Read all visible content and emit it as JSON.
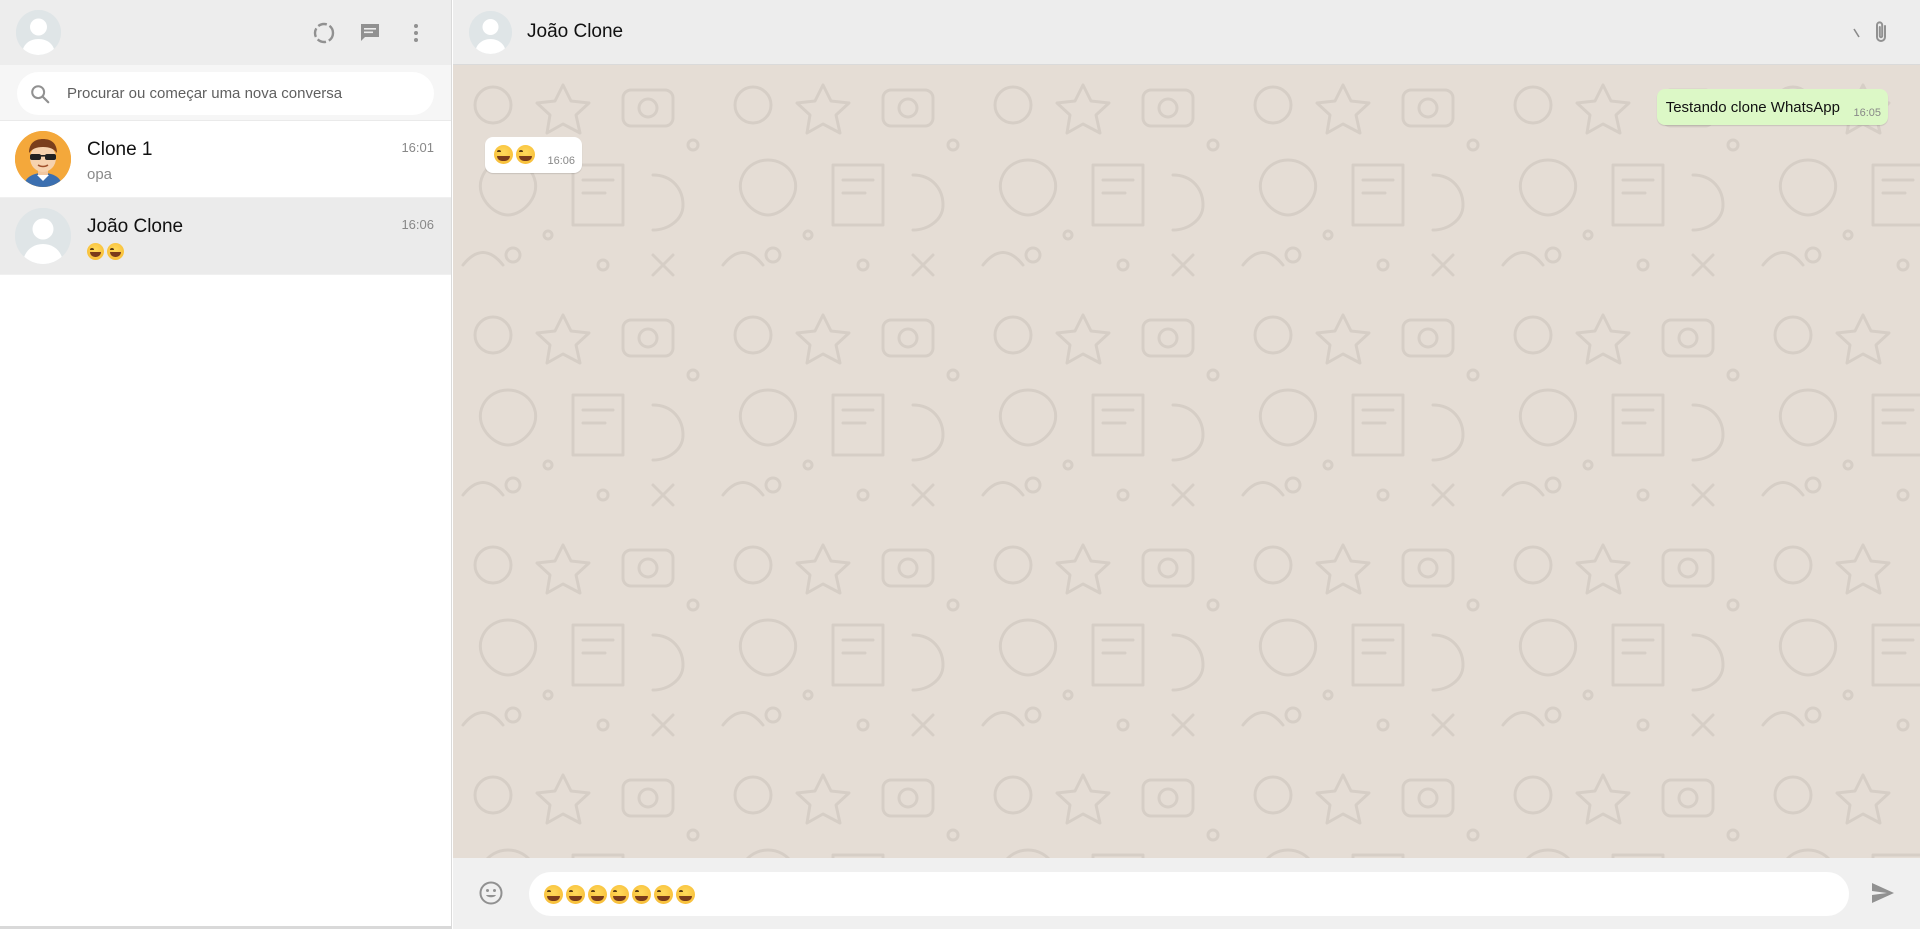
{
  "sidebar": {
    "icons": {
      "status": "status-icon",
      "new_chat": "message-icon",
      "menu": "menu-dots-icon"
    },
    "search": {
      "placeholder": "Procurar ou começar uma nova conversa",
      "value": ""
    },
    "chats": [
      {
        "name": "Clone 1",
        "time": "16:01",
        "last_message": "opa",
        "avatar": "cartoon-avatar"
      },
      {
        "name": "João Clone",
        "time": "16:06",
        "last_message_emoji_count": 2,
        "avatar": "default-avatar",
        "active": true
      }
    ]
  },
  "main": {
    "header": {
      "contact_name": "João Clone",
      "icons": {
        "attach": "paperclip-icon"
      }
    },
    "messages": [
      {
        "direction": "out",
        "text": "Testando clone WhatsApp",
        "time": "16:05"
      },
      {
        "direction": "in",
        "emoji_count": 2,
        "time": "16:06"
      }
    ],
    "composer": {
      "emoji_icon": "smile-icon",
      "draft_emoji_count": 7,
      "send_icon": "send-icon"
    }
  },
  "colors": {
    "header_bg": "#ededed",
    "chat_bg": "#e5ddd5",
    "outgoing_bubble": "#dcf8c6",
    "incoming_bubble": "#ffffff",
    "active_chat": "#ebebeb",
    "icon_gray": "#919191"
  }
}
